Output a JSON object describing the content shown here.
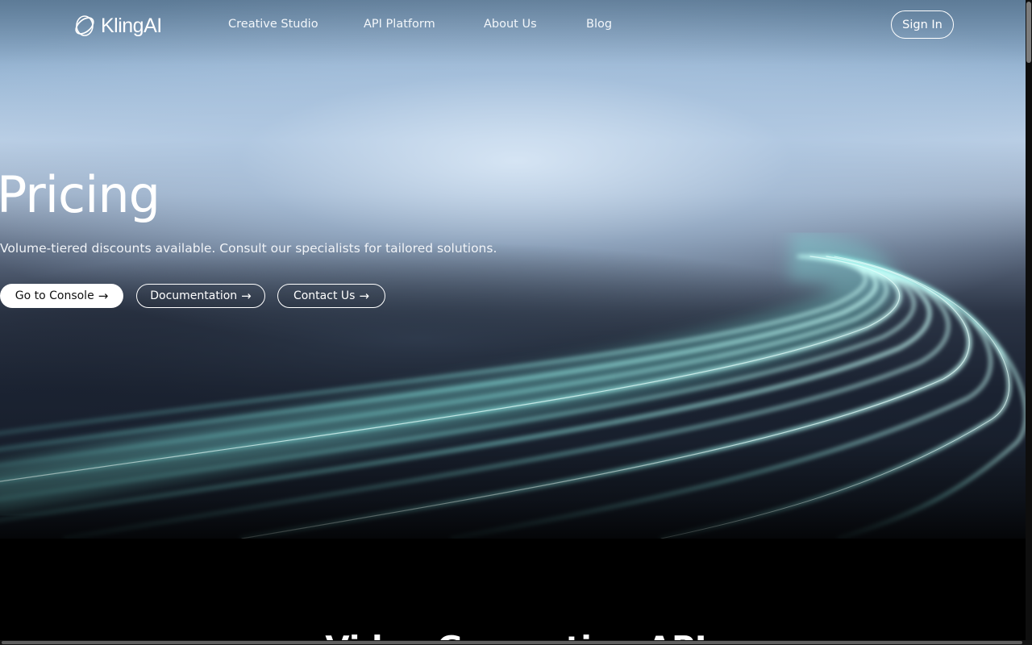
{
  "brand": {
    "name": "KlingAI",
    "logo_icon": "kling-logo-icon"
  },
  "nav": {
    "items": [
      {
        "label": "Creative Studio"
      },
      {
        "label": "API Platform"
      },
      {
        "label": "About Us"
      },
      {
        "label": "Blog"
      }
    ],
    "sign_in_label": "Sign In"
  },
  "hero": {
    "title": "Pricing",
    "subtitle": "Volume-tiered discounts available. Consult our specialists for tailored solutions.",
    "buttons": [
      {
        "label": "Go to Console",
        "icon": "arrow-right-icon"
      },
      {
        "label": "Documentation",
        "icon": "arrow-right-icon"
      },
      {
        "label": "Contact Us",
        "icon": "arrow-right-icon"
      }
    ],
    "arrow_glyph": "→"
  },
  "section": {
    "title": "Video Generation API"
  },
  "colors": {
    "accent_cyan": "#8ff0ea",
    "background": "#000000",
    "primary_button_bg": "#ffffff",
    "primary_button_text": "#111111"
  }
}
